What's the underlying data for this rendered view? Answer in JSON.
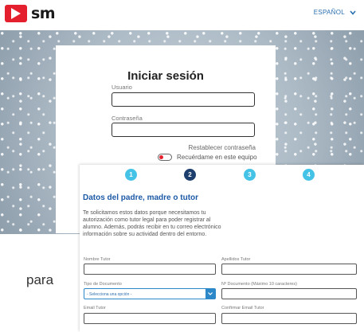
{
  "header": {
    "logo_text": "sm",
    "language_label": "ESPAÑOL",
    "accent_color": "#e5202e"
  },
  "login": {
    "title": "Iniciar sesión",
    "username_label": "Usuario",
    "username_value": "",
    "password_label": "Contraseña",
    "password_value": "",
    "reset_link": "Restablecer contraseña",
    "remember_label": "Recuérdame en este equipo"
  },
  "tutor_form": {
    "steps": [
      "1",
      "2",
      "3",
      "4"
    ],
    "active_step": 2,
    "title": "Datos del padre, madre o tutor",
    "description": "Te solicitamos estos datos porque necesitamos tu autorización como tutor legal para poder registrar al alumno. Además, podrás recibir en tu correo electrónico información sobre su actividad dentro del entorno.",
    "fields": {
      "nombre_label": "Nombre Tutor",
      "apellidos_label": "Apellidos Tutor",
      "tipo_doc_label": "Tipo de Documento",
      "tipo_doc_value": "- Selecciona una opción -",
      "num_doc_label": "Nº Documento (Máximo 10 caracteres)",
      "email_label": "Email Tutor",
      "confirm_email_label": "Confirmar Email Tutor"
    }
  },
  "side_text": "para"
}
